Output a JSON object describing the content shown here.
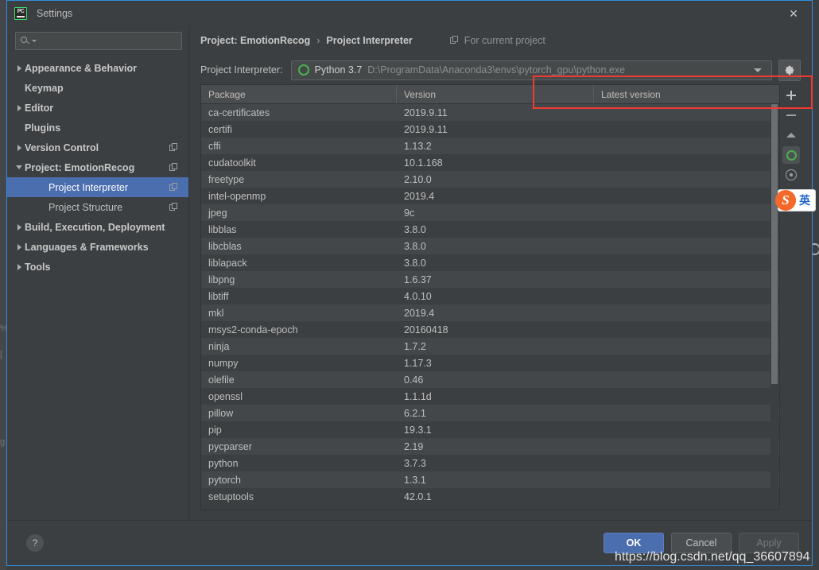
{
  "window": {
    "title": "Settings",
    "app_icon": "pycharm-logo-icon",
    "close_label": "✕",
    "border_color": "#2f8fe0"
  },
  "search": {
    "value": "",
    "placeholder": "",
    "icon": "search-icon"
  },
  "sidebar": {
    "items": [
      {
        "label": "Appearance & Behavior",
        "arrow": "right",
        "bold": true,
        "child": false,
        "copy": false,
        "selected": false
      },
      {
        "label": "Keymap",
        "arrow": "none",
        "bold": true,
        "child": false,
        "copy": false,
        "selected": false
      },
      {
        "label": "Editor",
        "arrow": "right",
        "bold": true,
        "child": false,
        "copy": false,
        "selected": false
      },
      {
        "label": "Plugins",
        "arrow": "none",
        "bold": true,
        "child": false,
        "copy": false,
        "selected": false
      },
      {
        "label": "Version Control",
        "arrow": "right",
        "bold": true,
        "child": false,
        "copy": true,
        "selected": false
      },
      {
        "label": "Project: EmotionRecog",
        "arrow": "down",
        "bold": true,
        "child": false,
        "copy": true,
        "selected": false
      },
      {
        "label": "Project Interpreter",
        "arrow": "none",
        "bold": false,
        "child": true,
        "copy": true,
        "selected": true
      },
      {
        "label": "Project Structure",
        "arrow": "none",
        "bold": false,
        "child": true,
        "copy": true,
        "selected": false
      },
      {
        "label": "Build, Execution, Deployment",
        "arrow": "right",
        "bold": true,
        "child": false,
        "copy": false,
        "selected": false
      },
      {
        "label": "Languages & Frameworks",
        "arrow": "right",
        "bold": true,
        "child": false,
        "copy": false,
        "selected": false
      },
      {
        "label": "Tools",
        "arrow": "right",
        "bold": true,
        "child": false,
        "copy": false,
        "selected": false
      }
    ]
  },
  "breadcrumb": {
    "project": "Project: EmotionRecog",
    "separator": "›",
    "page": "Project Interpreter",
    "scope_label": "For current project",
    "scope_icon": "copy-icon"
  },
  "interpreter": {
    "label": "Project Interpreter:",
    "icon": "python-env-icon",
    "name": "Python 3.7",
    "path": "D:\\ProgramData\\Anaconda3\\envs\\pytorch_gpu\\python.exe",
    "dropdown_icon": "chevron-down-icon",
    "gear_icon": "gear-icon",
    "highlight_color": "#f23a32"
  },
  "table": {
    "columns": [
      "Package",
      "Version",
      "Latest version"
    ],
    "rows": [
      {
        "package": "ca-certificates",
        "version": "2019.9.11",
        "latest": ""
      },
      {
        "package": "certifi",
        "version": "2019.9.11",
        "latest": ""
      },
      {
        "package": "cffi",
        "version": "1.13.2",
        "latest": ""
      },
      {
        "package": "cudatoolkit",
        "version": "10.1.168",
        "latest": ""
      },
      {
        "package": "freetype",
        "version": "2.10.0",
        "latest": ""
      },
      {
        "package": "intel-openmp",
        "version": "2019.4",
        "latest": ""
      },
      {
        "package": "jpeg",
        "version": "9c",
        "latest": ""
      },
      {
        "package": "libblas",
        "version": "3.8.0",
        "latest": ""
      },
      {
        "package": "libcblas",
        "version": "3.8.0",
        "latest": ""
      },
      {
        "package": "liblapack",
        "version": "3.8.0",
        "latest": ""
      },
      {
        "package": "libpng",
        "version": "1.6.37",
        "latest": ""
      },
      {
        "package": "libtiff",
        "version": "4.0.10",
        "latest": ""
      },
      {
        "package": "mkl",
        "version": "2019.4",
        "latest": ""
      },
      {
        "package": "msys2-conda-epoch",
        "version": "20160418",
        "latest": ""
      },
      {
        "package": "ninja",
        "version": "1.7.2",
        "latest": ""
      },
      {
        "package": "numpy",
        "version": "1.17.3",
        "latest": ""
      },
      {
        "package": "olefile",
        "version": "0.46",
        "latest": ""
      },
      {
        "package": "openssl",
        "version": "1.1.1d",
        "latest": ""
      },
      {
        "package": "pillow",
        "version": "6.2.1",
        "latest": ""
      },
      {
        "package": "pip",
        "version": "19.3.1",
        "latest": ""
      },
      {
        "package": "pycparser",
        "version": "2.19",
        "latest": ""
      },
      {
        "package": "python",
        "version": "3.7.3",
        "latest": ""
      },
      {
        "package": "pytorch",
        "version": "1.3.1",
        "latest": ""
      },
      {
        "package": "setuptools",
        "version": "42.0.1",
        "latest": ""
      }
    ],
    "loading_icon": "loading-spinner-icon"
  },
  "table_tools": [
    {
      "name": "add-package-button",
      "icon": "plus-icon"
    },
    {
      "name": "remove-package-button",
      "icon": "minus-icon"
    },
    {
      "name": "upgrade-package-button",
      "icon": "up-triangle-icon"
    },
    {
      "name": "show-env-button",
      "icon": "green-circle-icon"
    },
    {
      "name": "show-early-releases-button",
      "icon": "eye-icon"
    }
  ],
  "footer": {
    "help_label": "?",
    "ok_label": "OK",
    "cancel_label": "Cancel",
    "apply_label": "Apply"
  },
  "overlays": {
    "watermark": "https://blog.csdn.net/qq_36607894",
    "ime": {
      "logo": "S",
      "mode": "英"
    }
  }
}
